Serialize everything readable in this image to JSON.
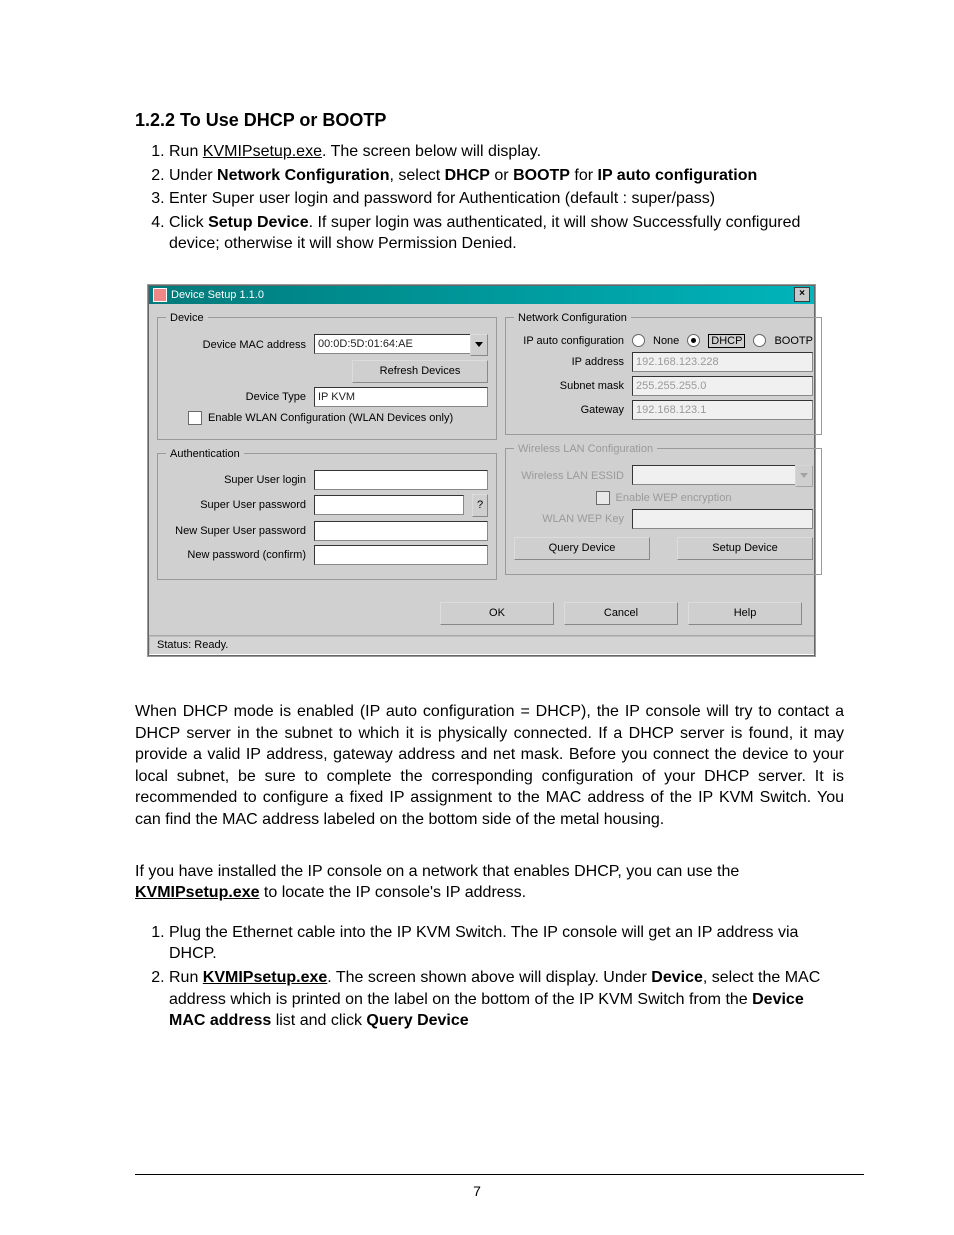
{
  "doc": {
    "section_title": "1.2.2 To Use DHCP or BOOTP",
    "steps1": [
      {
        "pre": "Run ",
        "u": "KVMIPsetup.exe",
        "post": ". The screen below will display."
      },
      {
        "pre": "Under ",
        "b1": "Network Configuration",
        "mid": ", select ",
        "b2": "DHCP",
        "mid2": " or ",
        "b3": "BOOTP",
        "mid3": " for ",
        "b4": "IP auto configuration"
      },
      {
        "plain": "Enter Super user login and password for Authentication (default : super/pass)"
      },
      {
        "pre": "Click ",
        "b1": "Setup Device",
        "post": ". If super login was authenticated, it will show Successfully configured device; otherwise it will show Permission Denied."
      }
    ],
    "para1": "When DHCP mode is enabled (IP auto configuration = DHCP), the IP console will try to contact a DHCP server in the subnet to which it is physically connected. If a DHCP server is found, it may provide a valid IP address, gateway address and net mask. Before you connect the device to your local subnet, be sure to complete the corresponding configuration of your DHCP server. It is recommended to configure a fixed IP assignment to the MAC address of the IP KVM Switch. You can find the MAC address labeled on the bottom side of the metal housing.",
    "para2_pre": "If you have installed the IP console on a network that enables DHCP, you can use the ",
    "para2_u": "KVMIPsetup.exe",
    "para2_post": " to locate the IP console's IP address.",
    "steps2": [
      "Plug the Ethernet cable into the IP KVM Switch. The IP console will get an IP address via DHCP.",
      "Run KVMIPsetup.exe. The screen shown above will display. Under Device, select the MAC address which is printed on the label on the bottom of the IP KVM Switch from the Device MAC address list and click Query Device"
    ],
    "page_number": "7"
  },
  "dlg": {
    "title": "Device Setup 1.1.0",
    "device": {
      "legend": "Device",
      "mac_label": "Device MAC address",
      "mac_value": "00:0D:5D:01:64:AE",
      "refresh_label": "Refresh Devices",
      "type_label": "Device Type",
      "type_value": "IP KVM",
      "wlan_chk_label": "Enable WLAN Configuration (WLAN Devices only)"
    },
    "auth": {
      "legend": "Authentication",
      "login_label": "Super User login",
      "pwd_label": "Super User password",
      "newpwd_label": "New Super User password",
      "conf_label": "New password (confirm)",
      "q": "?"
    },
    "net": {
      "legend": "Network Configuration",
      "autolabel": "IP auto configuration",
      "opt_none": "None",
      "opt_dhcp": "DHCP",
      "opt_bootp": "BOOTP",
      "ip_label": "IP address",
      "ip_value": "192.168.123.228",
      "mask_label": "Subnet mask",
      "mask_value": "255.255.255.0",
      "gw_label": "Gateway",
      "gw_value": "192.168.123.1"
    },
    "wlan": {
      "legend": "Wireless LAN Configuration",
      "essid_label": "Wireless LAN ESSID",
      "wep_chk_label": "Enable WEP encryption",
      "wepkey_label": "WLAN WEP Key",
      "query_label": "Query Device",
      "setup_label": "Setup Device"
    },
    "ok": "OK",
    "cancel": "Cancel",
    "help": "Help",
    "status": "Status: Ready."
  }
}
